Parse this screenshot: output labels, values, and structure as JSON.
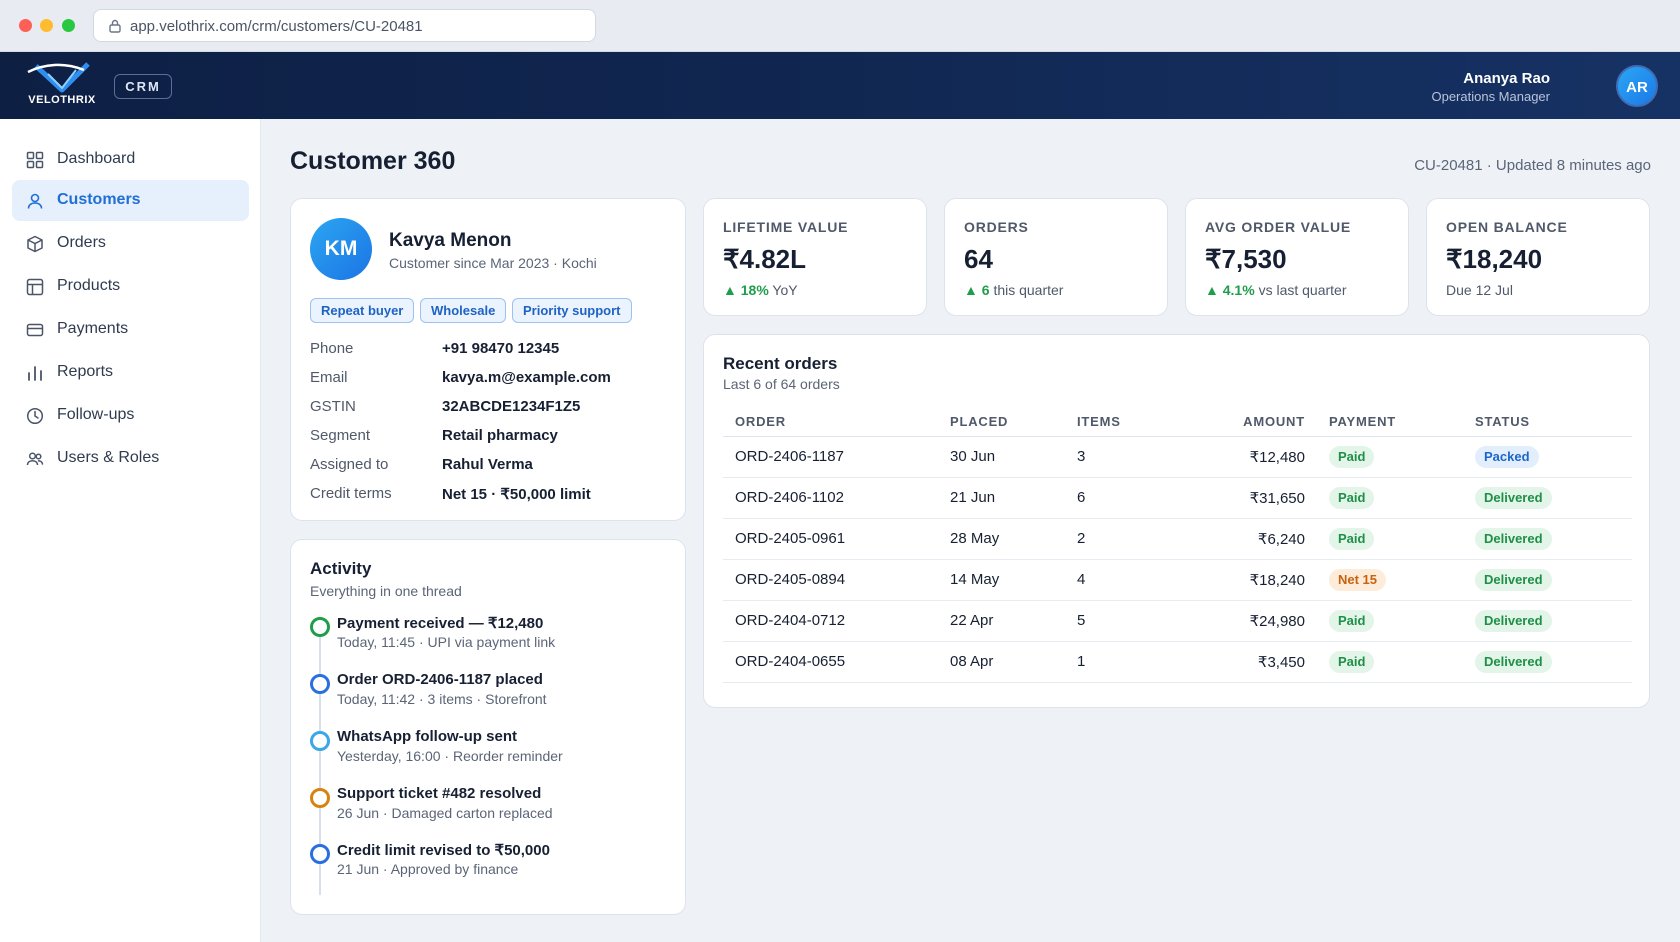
{
  "browser": {
    "url": "app.velothrix.com/crm/customers/CU-20481"
  },
  "header": {
    "logo_text": "VELOTHRIX",
    "product_badge": "CRM",
    "user": {
      "name": "Ananya Rao",
      "role": "Operations Manager",
      "initials": "AR"
    }
  },
  "sidebar": {
    "items": [
      {
        "label": "Dashboard",
        "icon": "grid-icon"
      },
      {
        "label": "Customers",
        "icon": "user-icon",
        "active": true
      },
      {
        "label": "Orders",
        "icon": "box-icon"
      },
      {
        "label": "Products",
        "icon": "layout-icon"
      },
      {
        "label": "Payments",
        "icon": "card-icon"
      },
      {
        "label": "Reports",
        "icon": "bar-chart-icon"
      },
      {
        "label": "Follow-ups",
        "icon": "clock-icon"
      },
      {
        "label": "Users & Roles",
        "icon": "users-icon"
      }
    ]
  },
  "page": {
    "title": "Customer 360",
    "meta": "CU-20481 · Updated 8 minutes ago"
  },
  "customer": {
    "initials": "KM",
    "name": "Kavya Menon",
    "since": "Customer since Mar 2023 · Kochi",
    "tags": [
      "Repeat buyer",
      "Wholesale",
      "Priority support"
    ],
    "fields": [
      {
        "label": "Phone",
        "value": "+91 98470 12345"
      },
      {
        "label": "Email",
        "value": "kavya.m@example.com"
      },
      {
        "label": "GSTIN",
        "value": "32ABCDE1234F1Z5"
      },
      {
        "label": "Segment",
        "value": "Retail pharmacy"
      },
      {
        "label": "Assigned to",
        "value": "Rahul Verma"
      },
      {
        "label": "Credit terms",
        "value": "Net 15 · ₹50,000 limit"
      }
    ]
  },
  "stats": [
    {
      "label": "LIFETIME VALUE",
      "value": "₹4.82L",
      "delta": "18%",
      "delta_suffix": "YoY"
    },
    {
      "label": "ORDERS",
      "value": "64",
      "delta": "6",
      "delta_suffix": "this quarter"
    },
    {
      "label": "AVG ORDER VALUE",
      "value": "₹7,530",
      "delta": "4.1%",
      "delta_suffix": "vs last quarter"
    },
    {
      "label": "OPEN BALANCE",
      "value": "₹18,240",
      "sub": "Due 12 Jul"
    }
  ],
  "activity": {
    "title": "Activity",
    "subtitle": "Everything in one thread",
    "items": [
      {
        "title": "Payment received — ₹12,480",
        "sub": "Today, 11:45 · UPI via payment link",
        "color": "#1f9d4c"
      },
      {
        "title": "Order ORD-2406-1187 placed",
        "sub": "Today, 11:42 · 3 items · Storefront",
        "color": "#2a6fe0"
      },
      {
        "title": "WhatsApp follow-up sent",
        "sub": "Yesterday, 16:00 · Reorder reminder",
        "color": "#3aa7e6"
      },
      {
        "title": "Support ticket #482 resolved",
        "sub": "26 Jun · Damaged carton replaced",
        "color": "#d9820f"
      },
      {
        "title": "Credit limit revised to ₹50,000",
        "sub": "21 Jun · Approved by finance",
        "color": "#2a6fe0"
      }
    ]
  },
  "orders": {
    "title": "Recent orders",
    "subtitle": "Last 6 of 64 orders",
    "columns": [
      "ORDER",
      "PLACED",
      "ITEMS",
      "AMOUNT",
      "PAYMENT",
      "STATUS"
    ],
    "rows": [
      {
        "order": "ORD-2406-1187",
        "placed": "30 Jun",
        "items": "3",
        "amount": "₹12,480",
        "payment": "Paid",
        "status": "Packed"
      },
      {
        "order": "ORD-2406-1102",
        "placed": "21 Jun",
        "items": "6",
        "amount": "₹31,650",
        "payment": "Paid",
        "status": "Delivered"
      },
      {
        "order": "ORD-2405-0961",
        "placed": "28 May",
        "items": "2",
        "amount": "₹6,240",
        "payment": "Paid",
        "status": "Delivered"
      },
      {
        "order": "ORD-2405-0894",
        "placed": "14 May",
        "items": "4",
        "amount": "₹18,240",
        "payment": "Net 15",
        "status": "Delivered"
      },
      {
        "order": "ORD-2404-0712",
        "placed": "22 Apr",
        "items": "5",
        "amount": "₹24,980",
        "payment": "Paid",
        "status": "Delivered"
      },
      {
        "order": "ORD-2404-0655",
        "placed": "08 Apr",
        "items": "1",
        "amount": "₹3,450",
        "payment": "Paid",
        "status": "Delivered"
      }
    ]
  },
  "colors": {
    "accent": "#1f6fd6",
    "header_bg": "#0e1f44",
    "success": "#1f9d4c",
    "warning": "#c9620e"
  }
}
